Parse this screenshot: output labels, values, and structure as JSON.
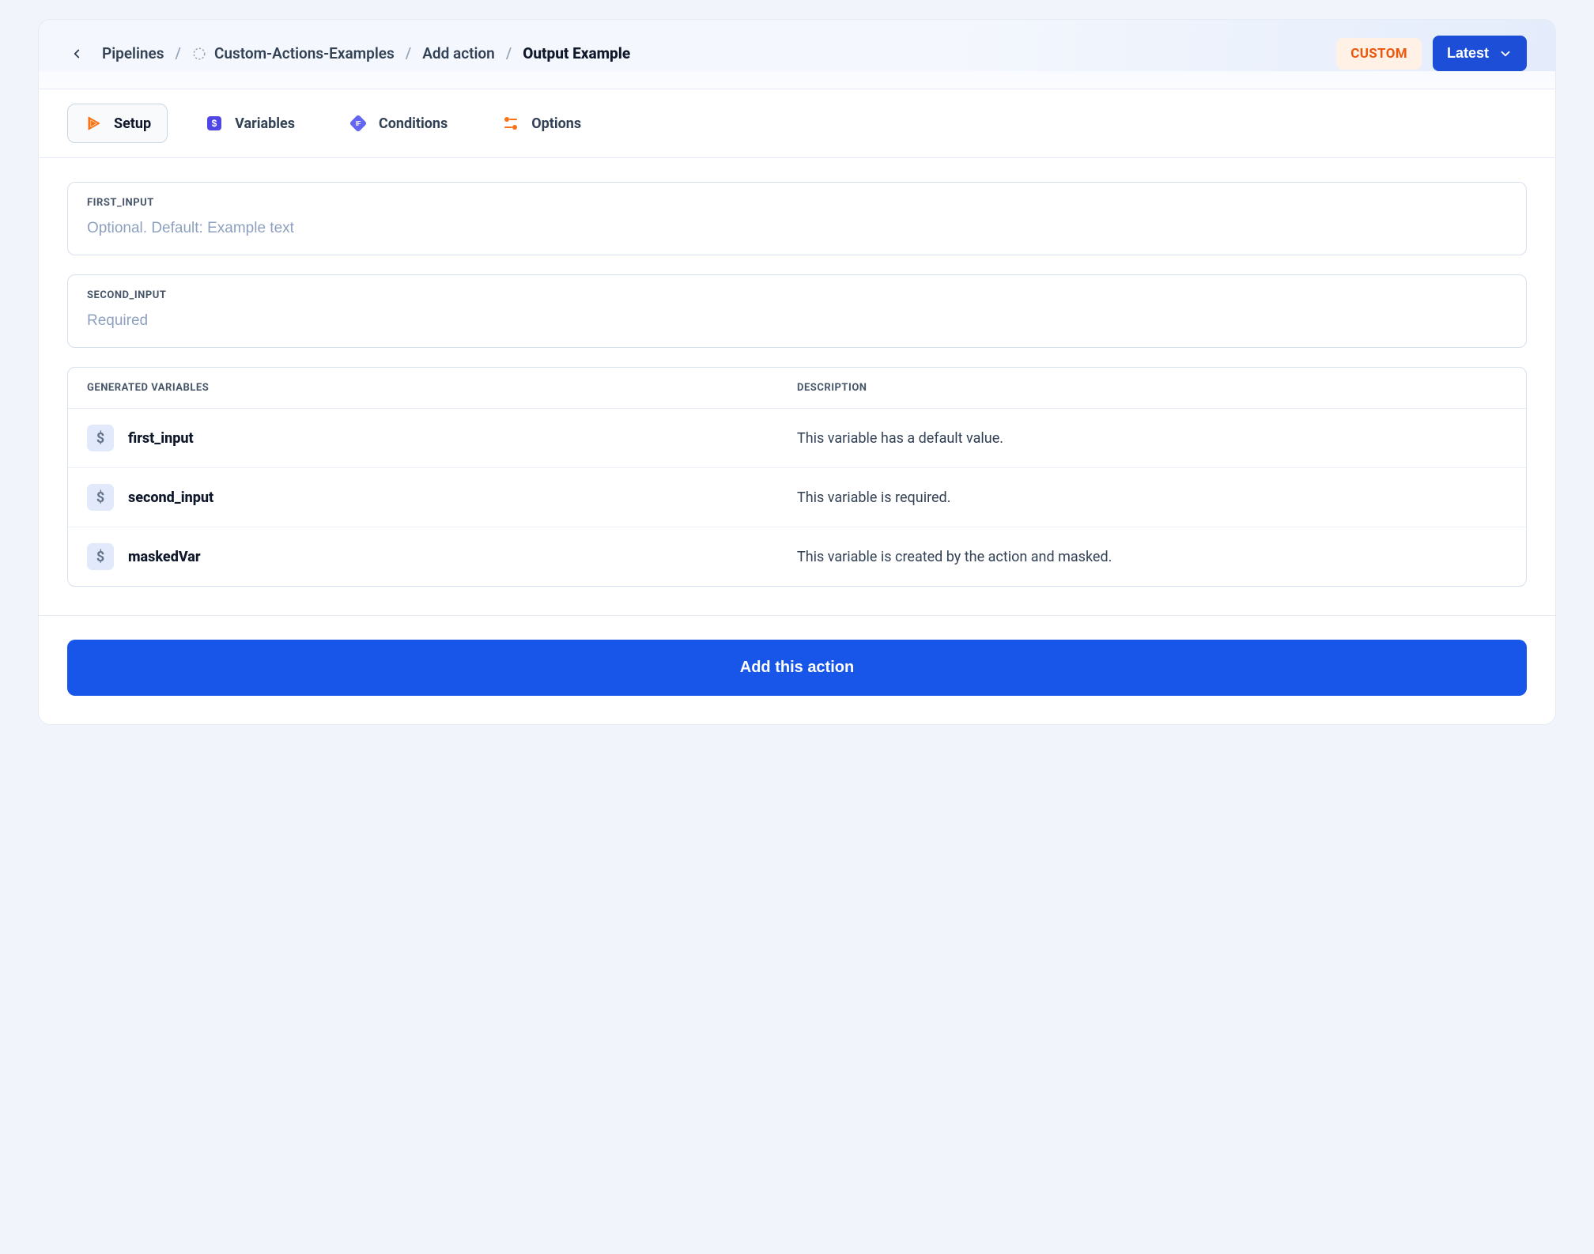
{
  "breadcrumbs": {
    "root": "Pipelines",
    "repo": "Custom-Actions-Examples",
    "add": "Add action",
    "current": "Output Example"
  },
  "header": {
    "badge": "CUSTOM",
    "version_label": "Latest"
  },
  "tabs": {
    "setup": "Setup",
    "variables": "Variables",
    "conditions": "Conditions",
    "options": "Options"
  },
  "inputs": {
    "first": {
      "label": "FIRST_INPUT",
      "placeholder": "Optional. Default: Example text",
      "value": ""
    },
    "second": {
      "label": "SECOND_INPUT",
      "placeholder": "Required",
      "value": ""
    }
  },
  "generated": {
    "head_name": "GENERATED VARIABLES",
    "head_desc": "DESCRIPTION",
    "rows": [
      {
        "name": "first_input",
        "desc": "This variable has a default value."
      },
      {
        "name": "second_input",
        "desc": "This variable is required."
      },
      {
        "name": "maskedVar",
        "desc": "This variable is created by the action and masked."
      }
    ]
  },
  "footer": {
    "submit": "Add this action"
  }
}
